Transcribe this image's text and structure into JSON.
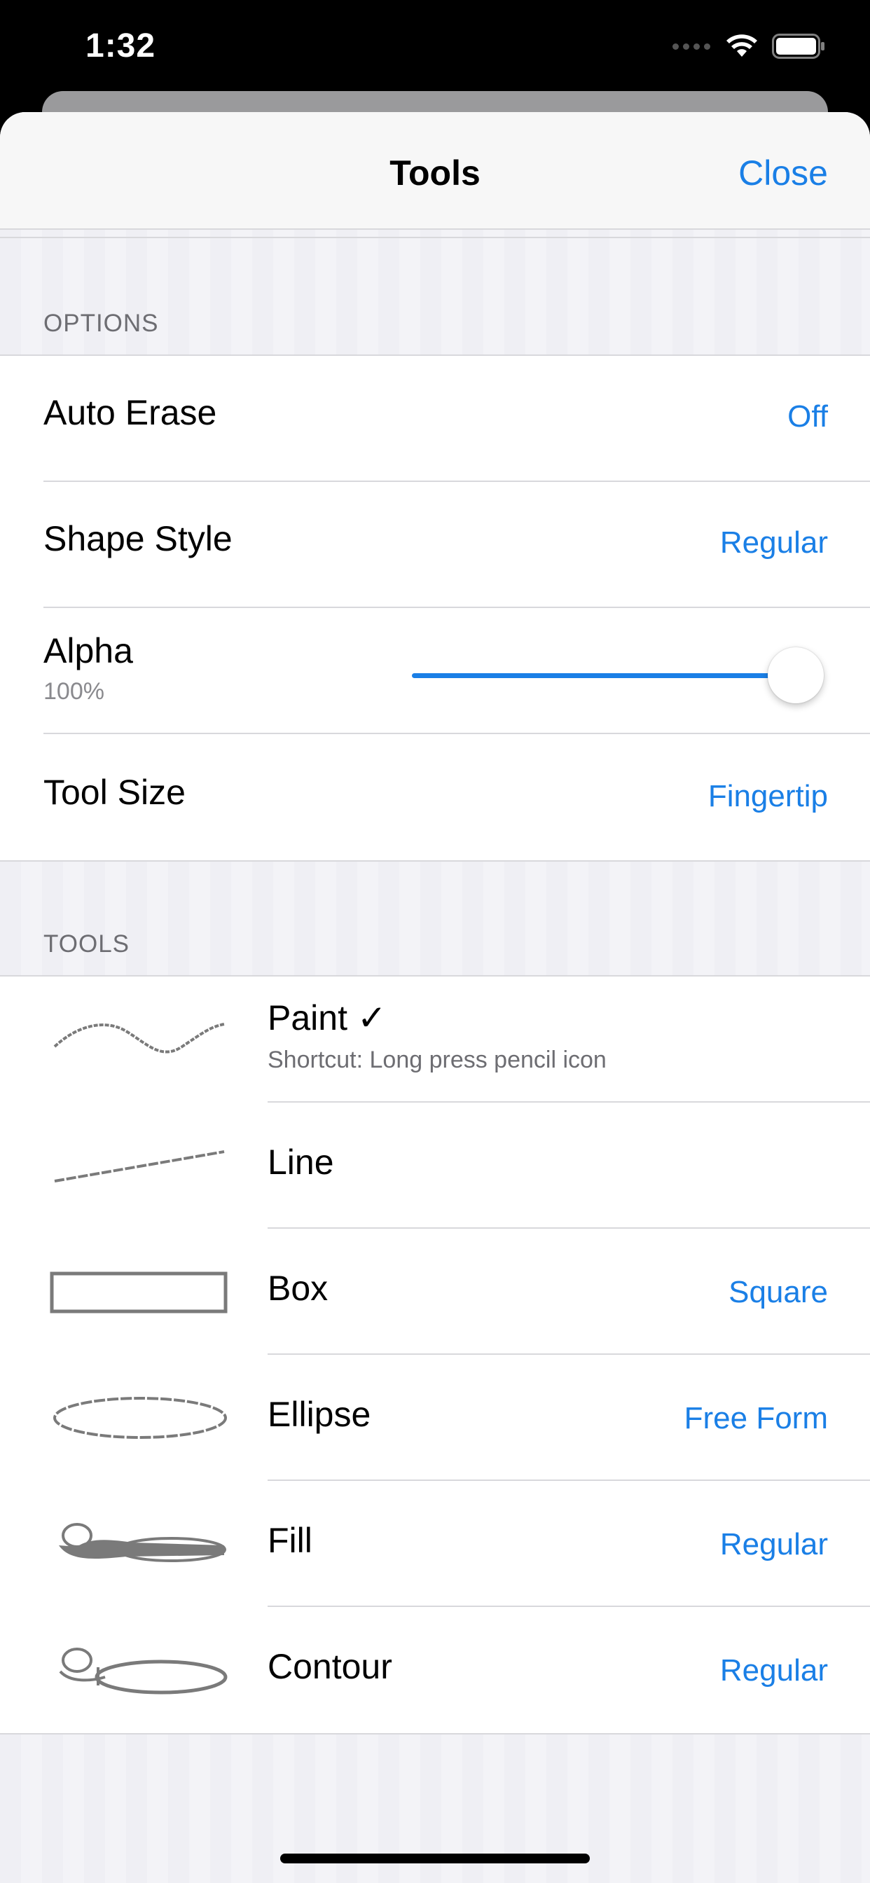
{
  "status_bar": {
    "time": "1:32"
  },
  "nav": {
    "title": "Tools",
    "close_label": "Close"
  },
  "options": {
    "header": "OPTIONS",
    "auto_erase": {
      "label": "Auto Erase",
      "value": "Off"
    },
    "shape_style": {
      "label": "Shape Style",
      "value": "Regular"
    },
    "alpha": {
      "label": "Alpha",
      "value_text": "100%",
      "level": 1.0
    },
    "tool_size": {
      "label": "Tool Size",
      "value": "Fingertip"
    }
  },
  "tools": {
    "header": "TOOLS",
    "items": [
      {
        "label": "Paint ✓",
        "subtitle": "Shortcut: Long press pencil icon",
        "value": "",
        "icon": "paint-stroke-icon"
      },
      {
        "label": "Line",
        "value": "",
        "icon": "line-icon"
      },
      {
        "label": "Box",
        "value": "Square",
        "icon": "box-icon"
      },
      {
        "label": "Ellipse",
        "value": "Free Form",
        "icon": "ellipse-icon"
      },
      {
        "label": "Fill",
        "value": "Regular",
        "icon": "fill-bucket-icon"
      },
      {
        "label": "Contour",
        "value": "Regular",
        "icon": "contour-icon"
      }
    ]
  },
  "colors": {
    "accent": "#1a7fe6",
    "background": "#efeff4"
  }
}
